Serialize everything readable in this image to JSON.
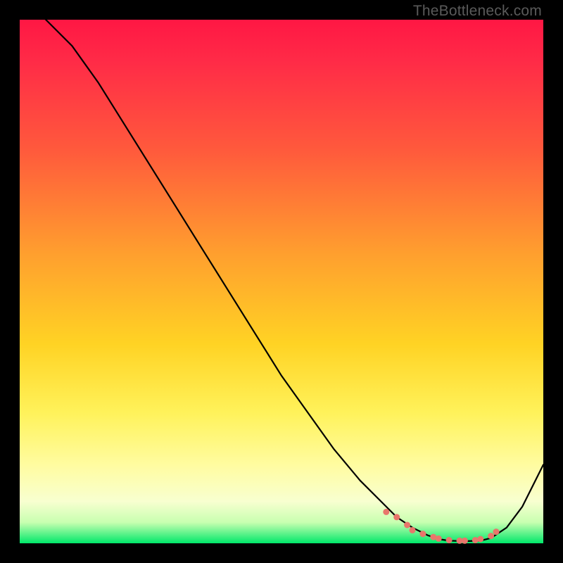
{
  "watermark": "TheBottleneck.com",
  "chart_data": {
    "type": "line",
    "title": "",
    "xlabel": "",
    "ylabel": "",
    "xlim": [
      0,
      100
    ],
    "ylim": [
      0,
      100
    ],
    "series": [
      {
        "name": "curve",
        "x": [
          0,
          5,
          10,
          15,
          20,
          25,
          30,
          35,
          40,
          45,
          50,
          55,
          60,
          65,
          70,
          72,
          75,
          78,
          80,
          82,
          85,
          88,
          90,
          93,
          96,
          100
        ],
        "y": [
          105,
          100,
          95,
          88,
          80,
          72,
          64,
          56,
          48,
          40,
          32,
          25,
          18,
          12,
          7,
          5,
          3,
          1.5,
          0.8,
          0.5,
          0.4,
          0.5,
          1,
          3,
          7,
          15
        ]
      }
    ],
    "markers": {
      "name": "dots",
      "x": [
        70,
        72,
        74,
        75,
        77,
        79,
        80,
        82,
        84,
        85,
        87,
        88,
        90,
        91
      ],
      "y": [
        6,
        5,
        3.5,
        2.5,
        1.8,
        1.2,
        0.9,
        0.6,
        0.5,
        0.5,
        0.6,
        0.8,
        1.4,
        2.2
      ]
    },
    "gradient_stops": [
      {
        "pos": 0,
        "color": "#ff1744"
      },
      {
        "pos": 25,
        "color": "#ff5a3c"
      },
      {
        "pos": 50,
        "color": "#ffc02e"
      },
      {
        "pos": 75,
        "color": "#fff25a"
      },
      {
        "pos": 95,
        "color": "#d8ffc0"
      },
      {
        "pos": 100,
        "color": "#00e86a"
      }
    ]
  }
}
